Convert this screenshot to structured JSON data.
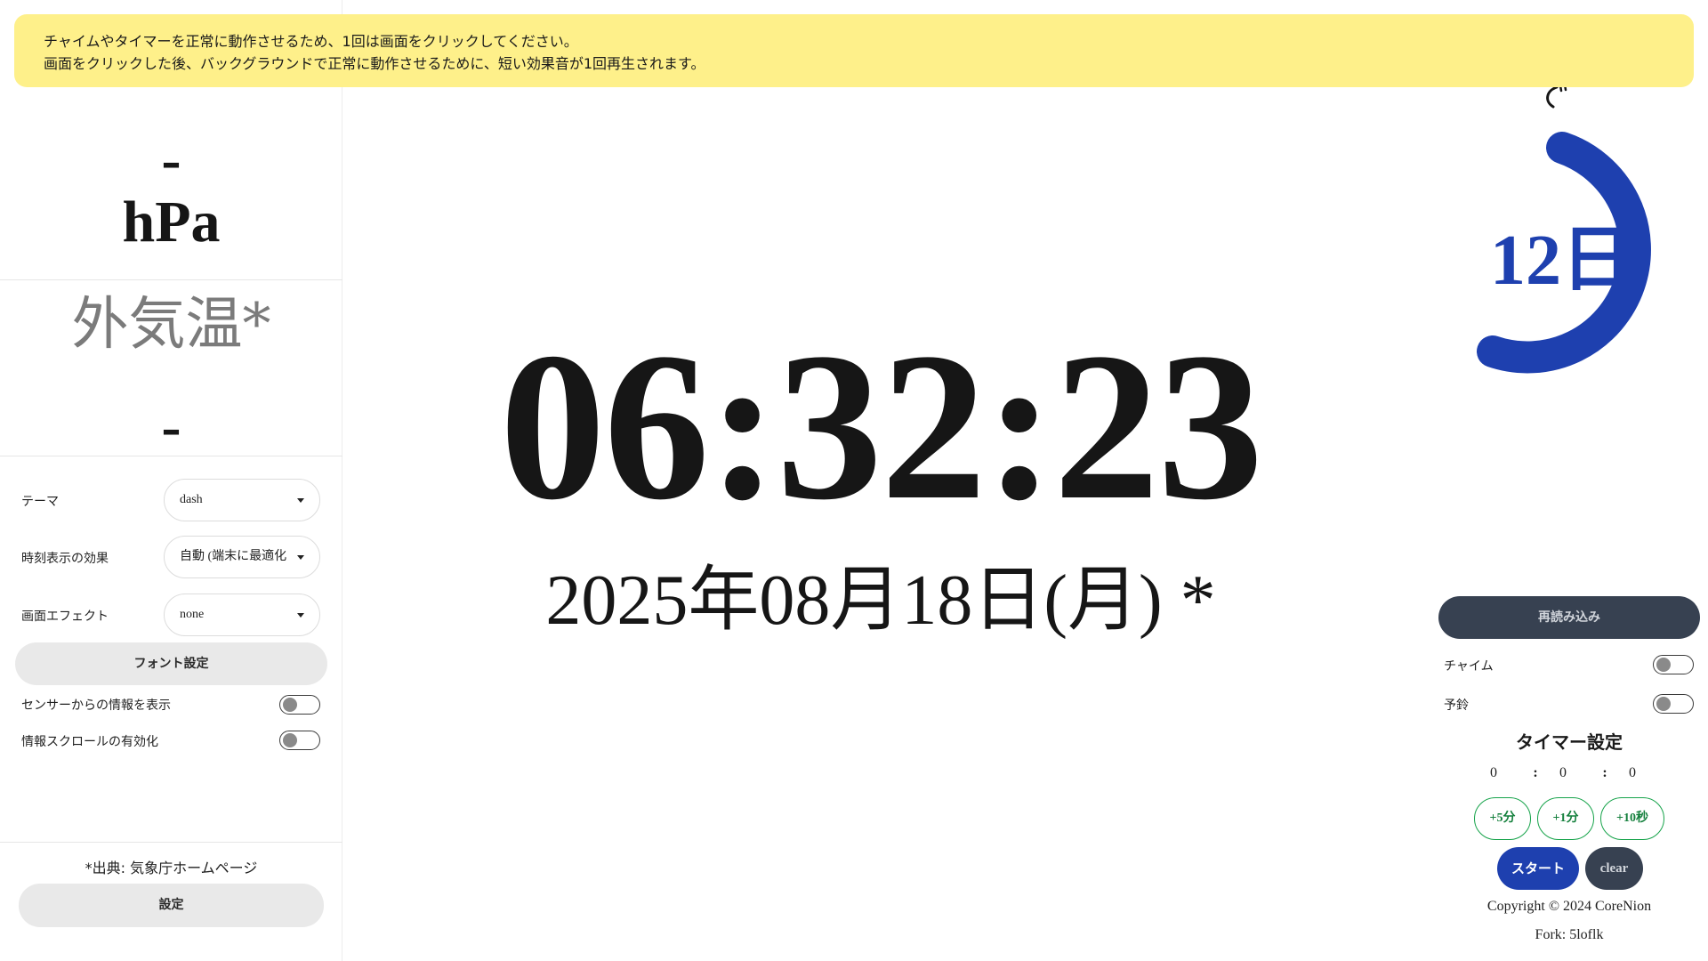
{
  "notice": {
    "line1": "チャイムやタイマーを正常に動作させるため、1回は画面をクリックしてください。",
    "line2": "画面をクリックした後、バックグラウンドで正常に動作させるために、短い効果音が1回再生されます。"
  },
  "sensor": {
    "pressure_value": "-",
    "pressure_unit": "hPa",
    "outside_temp_label": "外気温*",
    "outside_temp_value": "-"
  },
  "settings": {
    "theme_label": "テーマ",
    "theme_value": "dash",
    "effect_label": "時刻表示の効果",
    "effect_value": "自動 (端末に最適化",
    "screen_effect_label": "画面エフェクト",
    "screen_effect_value": "none",
    "font_button": "フォント設定",
    "show_sensor_label": "センサーからの情報を表示",
    "show_sensor_on": false,
    "scroll_label": "情報スクロールの有効化",
    "scroll_on": false,
    "source": "*出典: 気象庁ホームページ",
    "settings_button": "設定"
  },
  "clock": {
    "time": "06:32:23",
    "date": "2025年08月18日(月) *"
  },
  "day_ring": {
    "label": "12日",
    "accent_color": "#1e40af"
  },
  "controls": {
    "reload_button": "再読み込み",
    "chime_label": "チャイム",
    "chime_on": false,
    "alarm_label": "予鈴",
    "alarm_on": false
  },
  "timer": {
    "title": "タイマー設定",
    "hours": "0",
    "minutes": "0",
    "seconds": "0",
    "separator": ":",
    "add5min": "+5分",
    "add1min": "+1分",
    "add10sec": "+10秒",
    "start": "スタート",
    "clear": "clear"
  },
  "footer": {
    "copyright": "Copyright © 2024 CoreNion",
    "fork": "Fork: 5loflk"
  }
}
